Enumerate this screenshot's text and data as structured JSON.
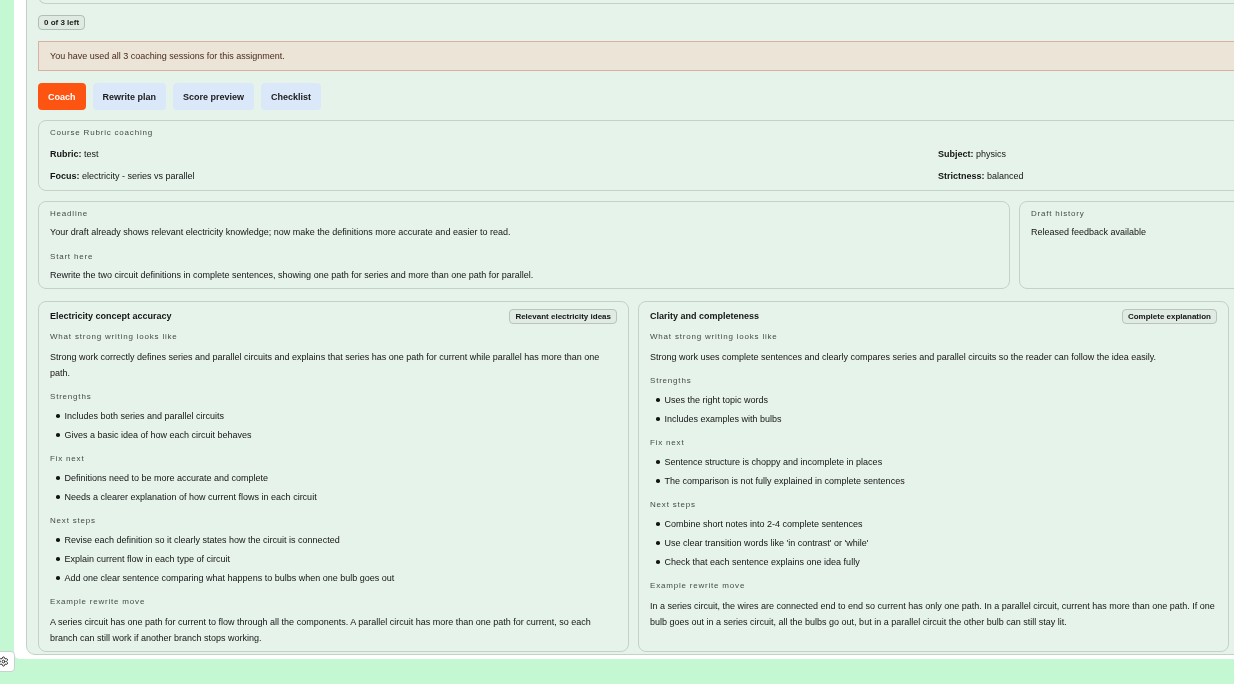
{
  "quota_badge": "0 of 3 left",
  "alert": "You have used all 3 coaching sessions for this assignment.",
  "tabs": [
    {
      "label": "Coach",
      "selected": true
    },
    {
      "label": "Rewrite plan",
      "selected": false
    },
    {
      "label": "Score preview",
      "selected": false
    },
    {
      "label": "Checklist",
      "selected": false
    }
  ],
  "rubric_card": {
    "title": "Course Rubric coaching",
    "fields": [
      "**Rubric:** test",
      "**Subject:** physics",
      "**Focus:** electricity - series vs parallel",
      "**Strictness:** balanced"
    ]
  },
  "summary_card": {
    "sections": [
      {
        "label": "Headline",
        "text": "Your draft already shows relevant electricity knowledge; now make the definitions more accurate and easier to read."
      },
      {
        "label": "Start here",
        "text": "Rewrite the two circuit definitions in complete sentences, showing one path for series and more than one path for parallel."
      }
    ]
  },
  "draft_history": {
    "label": "Draft history",
    "text": "Released feedback available"
  },
  "criteria": [
    {
      "title": "Electricity concept accuracy",
      "tag": "Relevant electricity ideas",
      "sections": [
        {
          "kind": "paragraph",
          "label": "What strong writing looks like",
          "text": "Strong work correctly defines series and parallel circuits and explains that series has one path for current while parallel has more than one path."
        },
        {
          "kind": "list",
          "label": "Strengths",
          "items": [
            "Includes both series and parallel circuits",
            "Gives a basic idea of how each circuit behaves"
          ]
        },
        {
          "kind": "list",
          "label": "Fix next",
          "items": [
            "Definitions need to be more accurate and complete",
            "Needs a clearer explanation of how current flows in each circuit"
          ]
        },
        {
          "kind": "list",
          "label": "Next steps",
          "items": [
            "Revise each definition so it clearly states how the circuit is connected",
            "Explain current flow in each type of circuit",
            "Add one clear sentence comparing what happens to bulbs when one bulb goes out"
          ]
        },
        {
          "kind": "paragraph",
          "label": "Example rewrite move",
          "text": "A series circuit has one path for current to flow through all the components. A parallel circuit has more than one path for current, so each branch can still work if another branch stops working."
        }
      ]
    },
    {
      "title": "Clarity and completeness",
      "tag": "Complete explanation",
      "sections": [
        {
          "kind": "paragraph",
          "label": "What strong writing looks like",
          "text": "Strong work uses complete sentences and clearly compares series and parallel circuits so the reader can follow the idea easily."
        },
        {
          "kind": "list",
          "label": "Strengths",
          "items": [
            "Uses the right topic words",
            "Includes examples with bulbs"
          ]
        },
        {
          "kind": "list",
          "label": "Fix next",
          "items": [
            "Sentence structure is choppy and incomplete in places",
            "The comparison is not fully explained in complete sentences"
          ]
        },
        {
          "kind": "list",
          "label": "Next steps",
          "items": [
            "Combine short notes into 2-4 complete sentences",
            "Use clear transition words like 'in contrast' or 'while'",
            "Check that each sentence explains one idea fully"
          ]
        },
        {
          "kind": "paragraph",
          "label": "Example rewrite move",
          "text": "In a series circuit, the wires are connected end to end so current has only one path. In a parallel circuit, current has more than one path. If one bulb goes out in a series circuit, all the bulbs go out, but in a parallel circuit the other bulb can still stay lit."
        }
      ]
    }
  ]
}
